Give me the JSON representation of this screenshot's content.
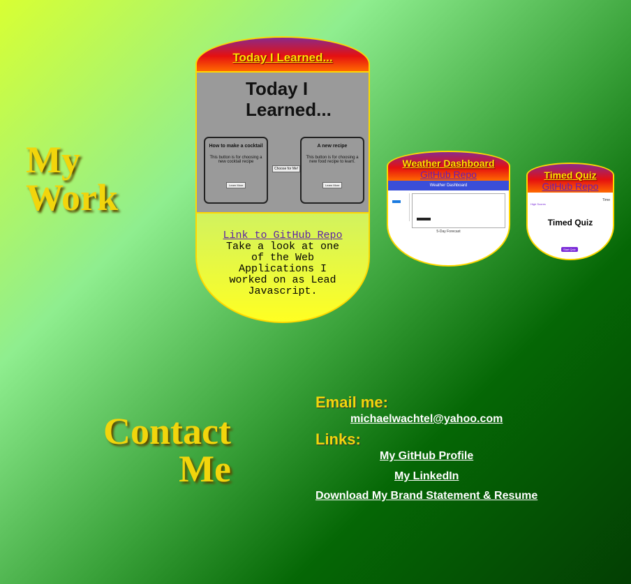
{
  "headings": {
    "work": "My Work",
    "contact": "Contact Me"
  },
  "projects": [
    {
      "title": "Today I Learned...",
      "repo_link": "Link to GitHub Repo",
      "description": "Take a look at one of the Web Applications I worked on as Lead Javascript.",
      "screenshot": {
        "title": "Today I Learned...",
        "box1_title": "How to make a cocktail",
        "box1_text": "This button is for choosing a new cocktail recipe",
        "box2_title": "A new recipe",
        "box2_text": "This button is for choosing a new food recipe to learn.",
        "button": "Learn More",
        "middle_button": "Choose for Me!"
      }
    },
    {
      "title": "Weather Dashboard",
      "repo_link": "GitHub Repo",
      "screenshot": {
        "header": "Weather Dashboard",
        "forecast_label": "5-Day Forecast"
      }
    },
    {
      "title": "Timed Quiz",
      "repo_link": "GitHub Repo",
      "screenshot": {
        "high_scores": "High Scores",
        "time": "Time",
        "title": "Timed Quiz",
        "button": "Start Quiz"
      }
    }
  ],
  "contact": {
    "email_label": "Email me:",
    "email": "michaelwachtel@yahoo.com",
    "links_label": "Links:",
    "github": "My GitHub Profile",
    "linkedin": "My LinkedIn",
    "resume": "Download My Brand Statement & Resume"
  }
}
